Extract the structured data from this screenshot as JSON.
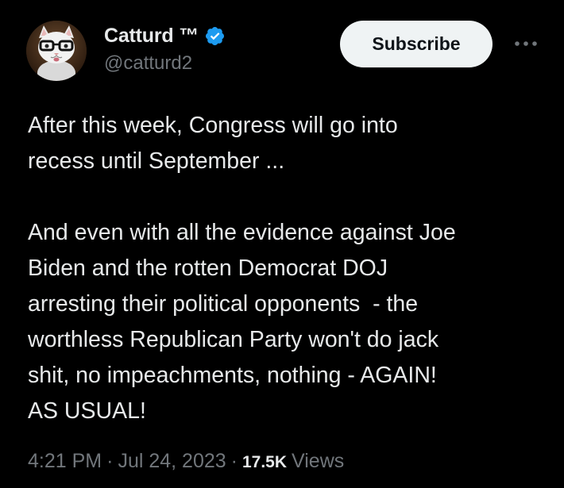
{
  "author": {
    "display_name": "Catturd ™",
    "handle": "@catturd2",
    "verified": true,
    "verified_color": "#1d9bf0",
    "avatar": "cat-with-glasses-avatar"
  },
  "actions": {
    "subscribe_label": "Subscribe",
    "more_icon": "ellipsis-icon"
  },
  "tweet": {
    "lines": [
      "After this week, Congress will go into",
      "recess until September ...",
      "",
      "And even with all the evidence against Joe",
      "Biden and the rotten Democrat DOJ",
      "arresting their political opponents  - the",
      "worthless Republican Party won't do jack",
      "shit, no impeachments, nothing - AGAIN!",
      "AS USUAL!"
    ]
  },
  "meta": {
    "time": "4:21 PM",
    "date": "Jul 24, 2023",
    "separator": "·",
    "views_count": "17.5K",
    "views_label": "Views"
  },
  "colors": {
    "background": "#000000",
    "primary_text": "#e7e9ea",
    "secondary_text": "#71767b",
    "button_bg": "#eff3f4",
    "button_text": "#0f1419"
  }
}
